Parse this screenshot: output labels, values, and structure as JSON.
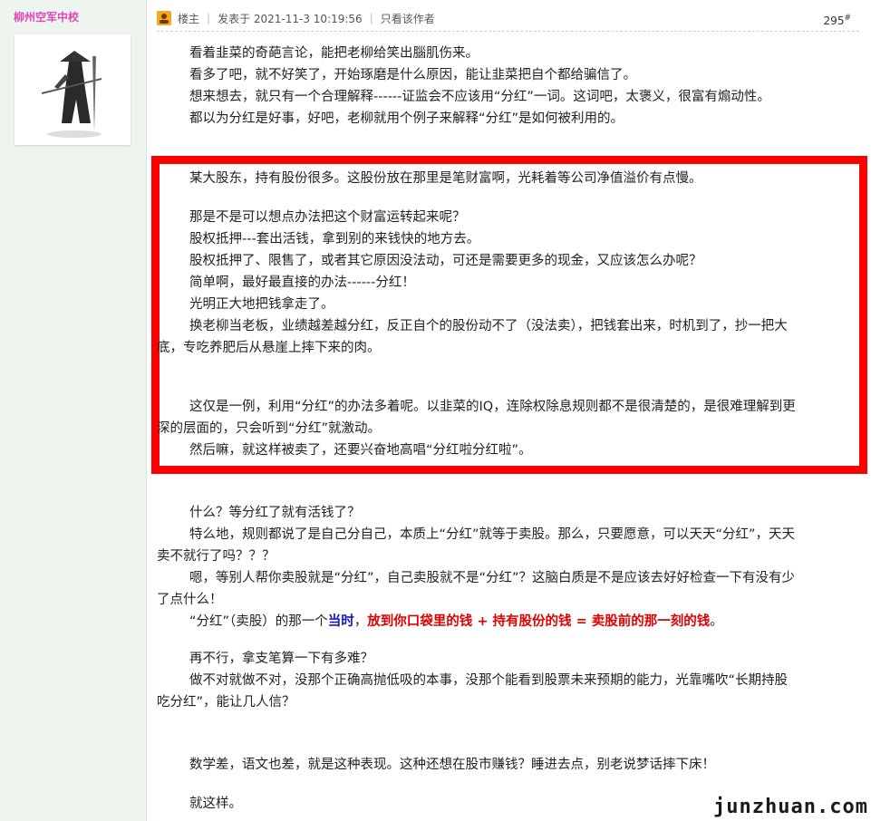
{
  "user": {
    "name": "柳州空军中校"
  },
  "post_header": {
    "role": "楼主",
    "posted": "发表于 2021-11-3 10:19:56",
    "only_author": "只看该作者",
    "floor": "295",
    "floor_mark": "#"
  },
  "paragraphs_top": [
    "看着韭菜的奇葩言论，能把老柳给笑出腦肌伤来。",
    "看多了吧，就不好笑了，开始琢磨是什么原因，能让韭菜把自个都给骗信了。",
    "想来想去，就只有一个合理解释------证监会不应该用“分红”一词。这词吧，太褒义，很富有煽动性。",
    "都以为分红是好事，好吧，老柳就用个例子来解释“分红”是如何被利用的。"
  ],
  "boxed": {
    "l1": "某大股东，持有股份很多。这股份放在那里是笔财富啊，光耗着等公司净值溢价有点慢。",
    "l2": "那是不是可以想点办法把这个财富运转起来呢？",
    "l3": "股权抵押---套出活钱，拿到别的来钱快的地方去。",
    "l4": "股权抵押了、限售了，或者其它原因没法动，可还是需要更多的现金，又应该怎么办呢？",
    "l5": "简单啊，最好最直接的办法------分红！",
    "l6": "光明正大地把钱拿走了。",
    "l7a": "换老柳当老板，业绩越差越分红，反正自个的股份动不了（没法卖），把钱套出来，时机到了，抄一把大",
    "l7b": "底，专吃养肥后从悬崖上摔下来的肉。",
    "l8a": "这仅是一例，利用“分红”的办法多着呢。以韭菜的IQ，连除权除息规则都不是很清楚的，是很难理解到更",
    "l8b": "深的层面的，只会听到“分红”就激动。",
    "l9": "然后嘛，就这样被卖了，还要兴奋地高唱“分红啦分红啦”。"
  },
  "bottom": {
    "b1": "什么？等分红了就有活钱了？",
    "b2a": "特么地，规则都说了是自己分自己，本质上“分红”就等于卖股。那么，只要愿意，可以天天“分红”，天天",
    "b2b": "卖不就行了吗？？？",
    "b3a": "嗯，等别人帮你卖股就是“分红”，自己卖股就不是“分红”？这脑白质是不是应该去好好检查一下有没有少",
    "b3b": "了点什么！",
    "b4_pre": "“分红”（卖股）的那一个",
    "b4_blue": "当时",
    "b4_comma": "，",
    "b4_red": "放到你口袋里的钱 + 持有股份的钱 = 卖股前的那一刻的钱",
    "b4_end": "。",
    "b5": "再不行，拿支笔算一下有多难？",
    "b6a": "做不对就做不对，没那个正确高抛低吸的本事，没那个能看到股票未来预期的能力，光靠嘴吹“长期持股",
    "b6b": "吃分红”，能让几人信？",
    "b7": "数学差，语文也差，就是这种表现。这种还想在股市赚钱？睡进去点，别老说梦话摔下床！",
    "b8": "就这样。"
  },
  "watermark": "junzhuan.com"
}
